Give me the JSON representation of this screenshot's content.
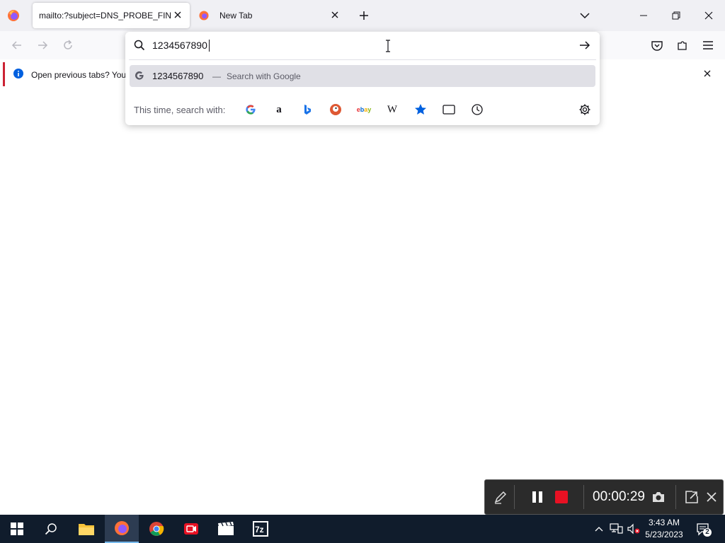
{
  "browser": {
    "tabs": [
      {
        "title": "mailto:?subject=DNS_PROBE_FINISHED",
        "active": true
      },
      {
        "title": "New Tab",
        "active": false
      }
    ]
  },
  "notification": {
    "text": "Open previous tabs? You"
  },
  "urlbar": {
    "value": "1234567890",
    "results": [
      {
        "title": "1234567890",
        "separator": "—",
        "action": "Search with Google",
        "icon": "google-icon"
      }
    ],
    "oneoff_label": "This time, search with:",
    "engines": [
      "google",
      "amazon",
      "bing",
      "duckduckgo",
      "ebay",
      "wikipedia",
      "bookmarks",
      "tabs",
      "history"
    ]
  },
  "recorder": {
    "time": "00:00:29",
    "stop_color": "#e81123"
  },
  "taskbar": {
    "time": "3:43 AM",
    "date": "5/23/2023",
    "notifications": "2",
    "apps": [
      "firefox",
      "chrome",
      "screen-recorder",
      "video-editor",
      "7zip"
    ]
  }
}
